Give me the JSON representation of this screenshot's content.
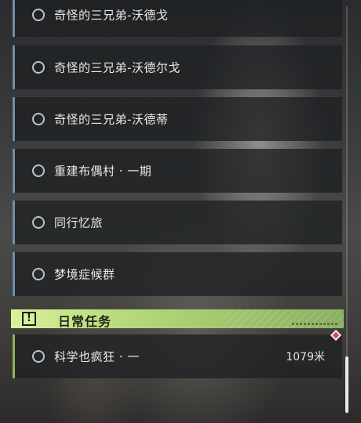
{
  "quests": [
    {
      "title": "奇怪的三兄弟-沃德戈"
    },
    {
      "title": "奇怪的三兄弟-沃德尔戈"
    },
    {
      "title": "奇怪的三兄弟-沃德蒂"
    },
    {
      "title": "重建布偶村 · 一期"
    },
    {
      "title": "同行忆旅"
    },
    {
      "title": "梦境症候群"
    }
  ],
  "daily_section": {
    "label": "日常任务",
    "badge_glyph": "!",
    "quest": {
      "title": "科学也疯狂 · 一",
      "distance": "1079米"
    }
  },
  "colors": {
    "quest_accent": "#6f8ea8",
    "daily_accent": "#8fb35a",
    "header_green": "#c6e48a",
    "track_marker": "#d24a55"
  },
  "icons": {
    "status": "circle-outline-icon",
    "section": "exclamation-box-icon",
    "tracked": "red-diamond-icon"
  }
}
